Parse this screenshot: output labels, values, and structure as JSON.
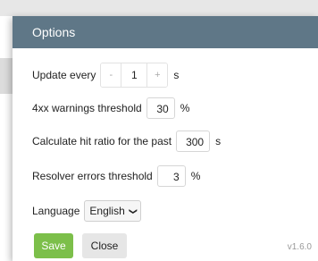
{
  "dialog": {
    "title": "Options"
  },
  "update_every": {
    "label": "Update every",
    "decrement": "-",
    "value": "1",
    "increment": "+",
    "unit": "s"
  },
  "warnings_4xx": {
    "label": "4xx warnings threshold",
    "value": "30",
    "unit": "%"
  },
  "hit_ratio": {
    "label": "Calculate hit ratio for the past",
    "value": "300",
    "unit": "s"
  },
  "resolver_errors": {
    "label": "Resolver errors threshold",
    "value": "3",
    "unit": "%"
  },
  "language": {
    "label": "Language",
    "selected": "English"
  },
  "buttons": {
    "save": "Save",
    "close": "Close"
  },
  "version": "v1.6.0",
  "colors": {
    "header": "#5f7787",
    "save": "#7cbf4a",
    "close": "#e6e6e6"
  }
}
